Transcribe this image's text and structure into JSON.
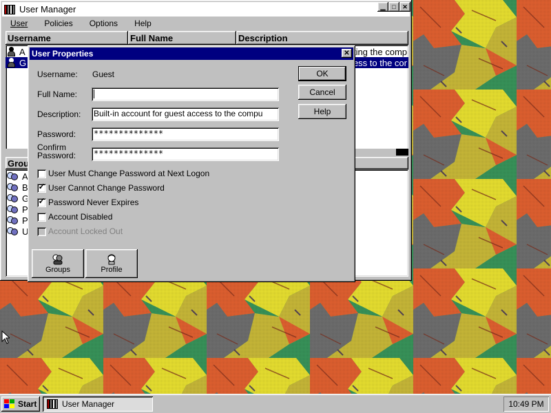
{
  "desktop": {
    "wallpaper": "leaves-tile",
    "colors": [
      "#e06030",
      "#e8e030",
      "#40a060",
      "#707070",
      "#c8b838"
    ]
  },
  "user_manager": {
    "title": "User Manager",
    "menu": [
      "User",
      "Policies",
      "Options",
      "Help"
    ],
    "columns": [
      "Username",
      "Full Name",
      "Description"
    ],
    "users": [
      {
        "username": "A",
        "description": "ting the comp",
        "selected": false
      },
      {
        "username": "G",
        "description": "ess to the cor",
        "selected": true
      }
    ],
    "groups_header": "Grou",
    "groups": [
      "A",
      "B",
      "G",
      "P",
      "P",
      "U"
    ]
  },
  "dialog": {
    "title": "User Properties",
    "username_label": "Username:",
    "username_value": "Guest",
    "fullname_label": "Full Name:",
    "fullname_value": "",
    "description_label": "Description:",
    "description_value": "Built-in account for guest access to the compu",
    "password_label": "Password:",
    "password_value": "**************",
    "confirm_label_1": "Confirm",
    "confirm_label_2": "Password:",
    "confirm_value": "**************",
    "checkboxes": [
      {
        "label": "User Must Change Password at Next Logon",
        "checked": false,
        "enabled": true
      },
      {
        "label": "User Cannot Change Password",
        "checked": true,
        "enabled": true
      },
      {
        "label": "Password Never Expires",
        "checked": true,
        "enabled": true
      },
      {
        "label": "Account Disabled",
        "checked": false,
        "enabled": true
      },
      {
        "label": "Account Locked Out",
        "checked": false,
        "enabled": false
      }
    ],
    "ok_label": "OK",
    "cancel_label": "Cancel",
    "help_label": "Help",
    "groups_label": "Groups",
    "profile_label": "Profile",
    "close_glyph": "✕",
    "check_glyph": "✓"
  },
  "taskbar": {
    "start_label": "Start",
    "task_label": "User Manager",
    "clock": "10:49 PM"
  }
}
